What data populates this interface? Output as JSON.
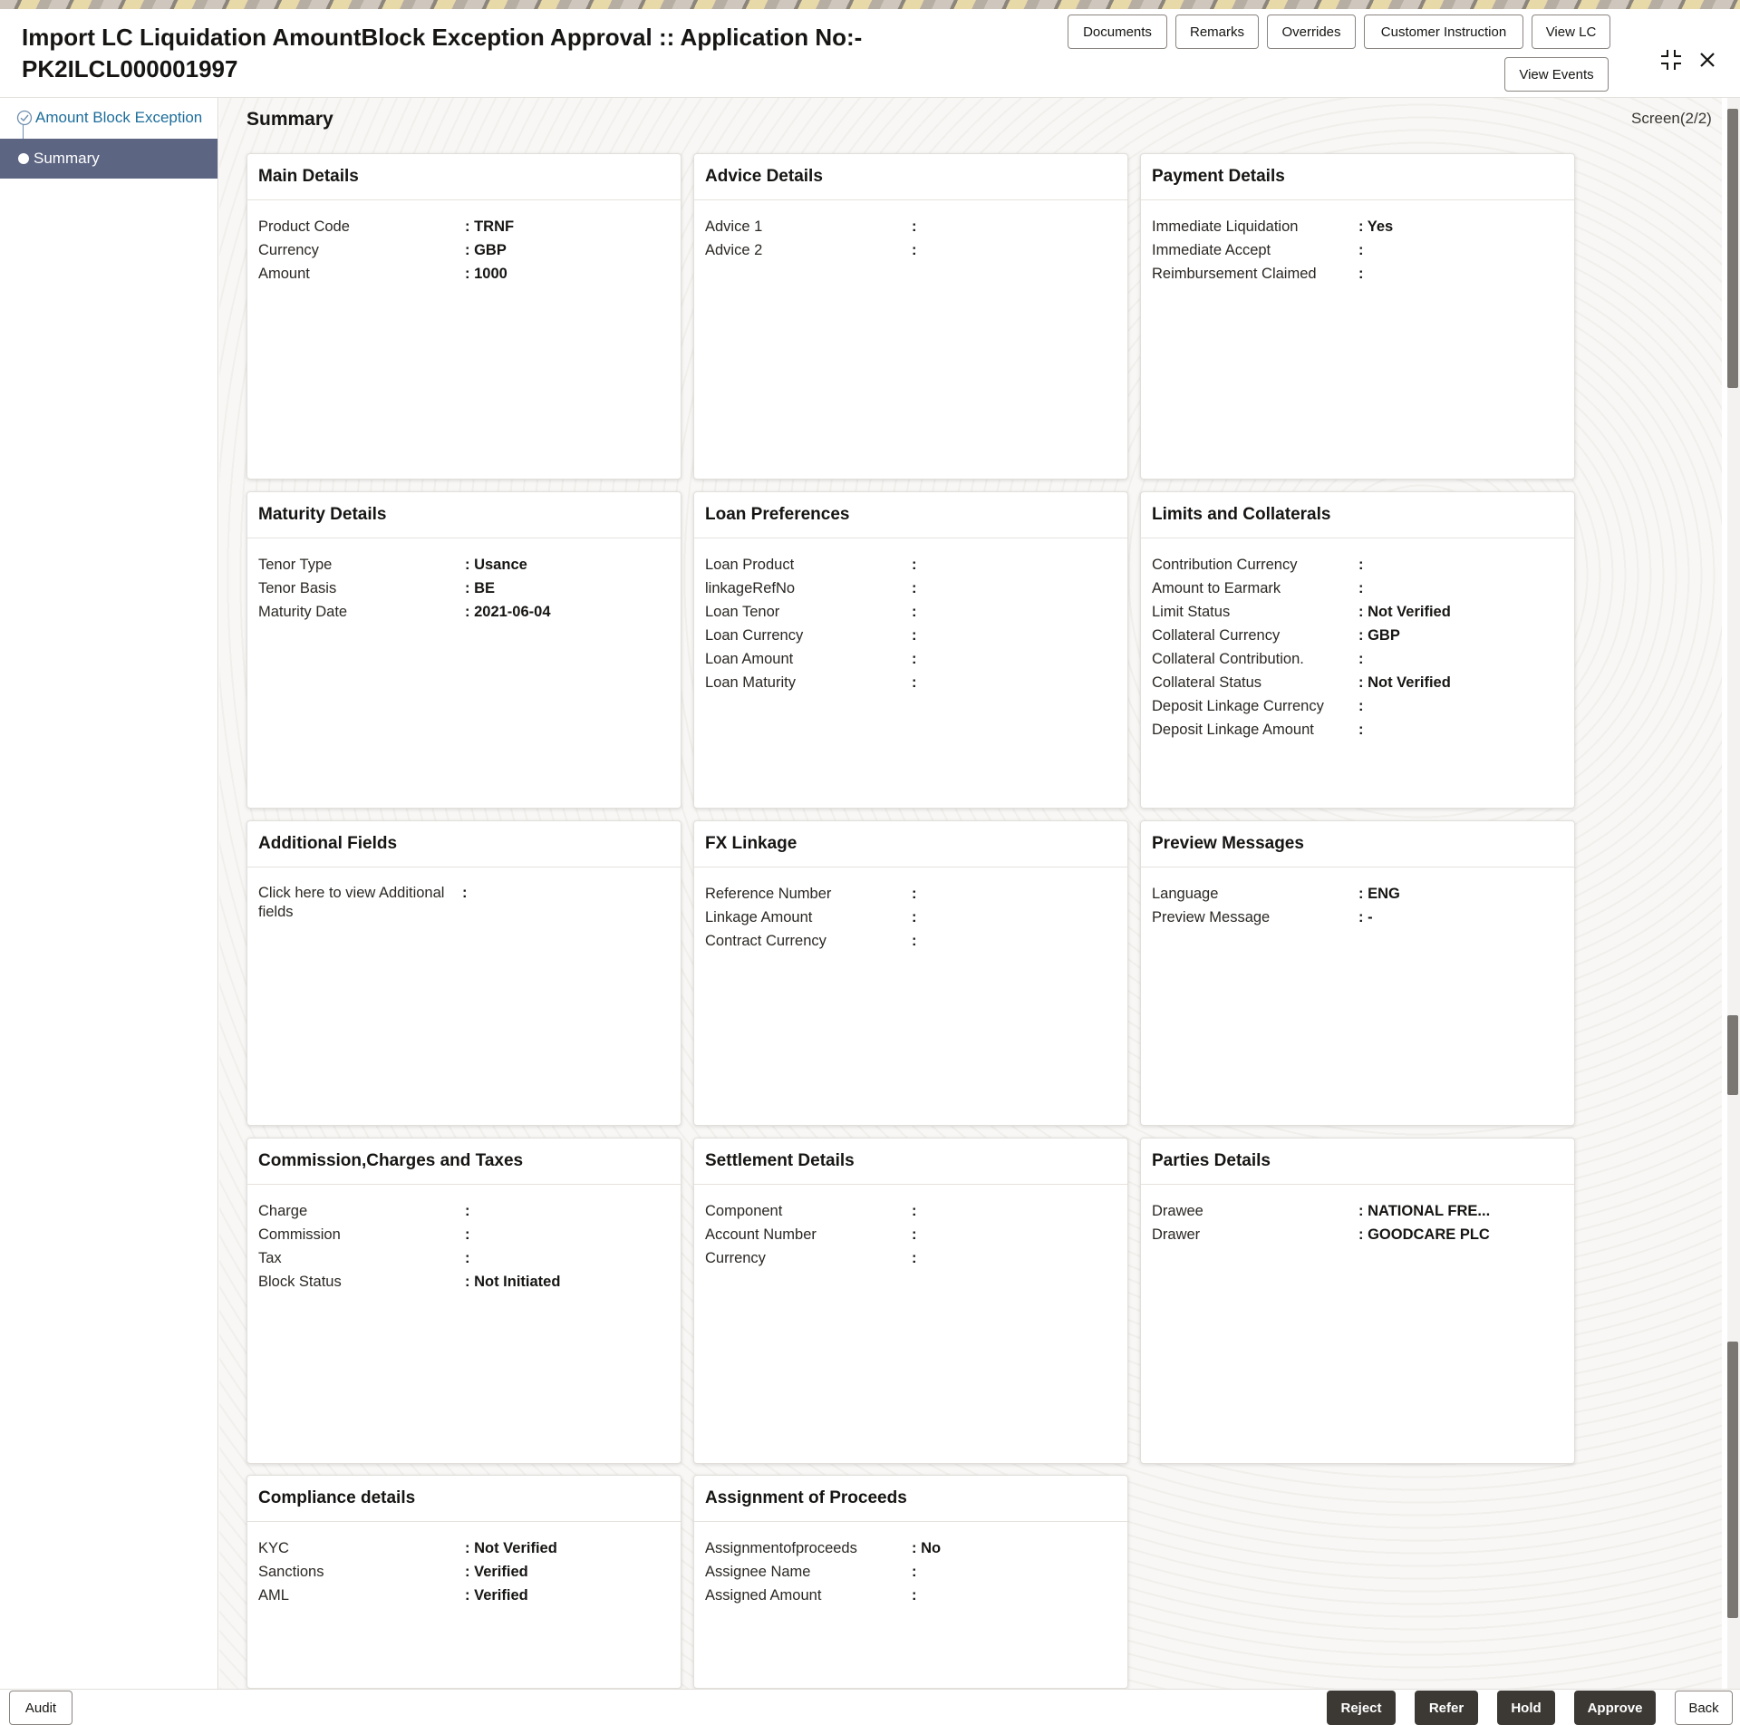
{
  "header": {
    "title_line1": "Import LC Liquidation AmountBlock Exception Approval :: Application No:-",
    "title_line2": "PK2ILCL000001997",
    "buttons": {
      "documents": "Documents",
      "remarks": "Remarks",
      "overrides": "Overrides",
      "customer_instruction": "Customer Instruction",
      "view_lc": "View LC",
      "view_events": "View Events"
    },
    "collapse_icon": "collapse-icon",
    "close_icon": "close-icon"
  },
  "sidebar": {
    "items": [
      {
        "label": "Amount Block Exception",
        "state": "completed"
      },
      {
        "label": "Summary",
        "state": "active"
      }
    ]
  },
  "main": {
    "title": "Summary",
    "screen": "Screen(2/2)"
  },
  "cards": {
    "main_details": {
      "title": "Main Details",
      "rows": [
        {
          "label": "Product Code",
          "value": "TRNF"
        },
        {
          "label": "Currency",
          "value": "GBP"
        },
        {
          "label": "Amount",
          "value": "1000"
        }
      ]
    },
    "advice_details": {
      "title": "Advice Details",
      "rows": [
        {
          "label": "Advice 1",
          "value": ""
        },
        {
          "label": "Advice 2",
          "value": ""
        }
      ]
    },
    "payment_details": {
      "title": "Payment Details",
      "rows": [
        {
          "label": "Immediate Liquidation",
          "value": "Yes"
        },
        {
          "label": "Immediate Accept",
          "value": ""
        },
        {
          "label": "Reimbursement Claimed",
          "value": ""
        }
      ]
    },
    "maturity_details": {
      "title": "Maturity Details",
      "rows": [
        {
          "label": "Tenor Type",
          "value": "Usance"
        },
        {
          "label": "Tenor Basis",
          "value": "BE"
        },
        {
          "label": "Maturity Date",
          "value": "2021-06-04"
        }
      ]
    },
    "loan_preferences": {
      "title": "Loan Preferences",
      "rows": [
        {
          "label": "Loan Product",
          "value": ""
        },
        {
          "label": "linkageRefNo",
          "value": ""
        },
        {
          "label": "Loan Tenor",
          "value": ""
        },
        {
          "label": "Loan Currency",
          "value": ""
        },
        {
          "label": "Loan Amount",
          "value": ""
        },
        {
          "label": "Loan Maturity",
          "value": ""
        }
      ]
    },
    "limits_collaterals": {
      "title": "Limits and Collaterals",
      "rows": [
        {
          "label": "Contribution Currency",
          "value": ""
        },
        {
          "label": "Amount to Earmark",
          "value": ""
        },
        {
          "label": "Limit Status",
          "value": "Not Verified"
        },
        {
          "label": "Collateral Currency",
          "value": "GBP"
        },
        {
          "label": "Collateral Contribution.",
          "value": ""
        },
        {
          "label": "Collateral Status",
          "value": "Not Verified"
        },
        {
          "label": "Deposit Linkage Currency",
          "value": ""
        },
        {
          "label": "Deposit Linkage Amount",
          "value": ""
        }
      ]
    },
    "additional_fields": {
      "title": "Additional Fields",
      "rows": [
        {
          "label": "Click here to view Additional fields",
          "value": ""
        }
      ]
    },
    "fx_linkage": {
      "title": "FX Linkage",
      "rows": [
        {
          "label": "Reference Number",
          "value": ""
        },
        {
          "label": "Linkage Amount",
          "value": ""
        },
        {
          "label": "Contract Currency",
          "value": ""
        }
      ]
    },
    "preview_messages": {
      "title": "Preview Messages",
      "rows": [
        {
          "label": "Language",
          "value": "ENG"
        },
        {
          "label": "Preview Message",
          "value": "-"
        }
      ]
    },
    "commission_charges": {
      "title": "Commission,Charges and Taxes",
      "rows": [
        {
          "label": "Charge",
          "value": ""
        },
        {
          "label": "Commission",
          "value": ""
        },
        {
          "label": "Tax",
          "value": ""
        },
        {
          "label": "Block Status",
          "value": "Not Initiated"
        }
      ]
    },
    "settlement_details": {
      "title": "Settlement Details",
      "rows": [
        {
          "label": "Component",
          "value": ""
        },
        {
          "label": "Account Number",
          "value": ""
        },
        {
          "label": "Currency",
          "value": ""
        }
      ]
    },
    "parties_details": {
      "title": "Parties Details",
      "rows": [
        {
          "label": "Drawee",
          "value": "NATIONAL FRE..."
        },
        {
          "label": "Drawer",
          "value": "GOODCARE PLC"
        }
      ]
    },
    "compliance_details": {
      "title": "Compliance details",
      "rows": [
        {
          "label": "KYC",
          "value": "Not Verified"
        },
        {
          "label": "Sanctions",
          "value": "Verified"
        },
        {
          "label": "AML",
          "value": "Verified"
        }
      ]
    },
    "assignment_proceeds": {
      "title": "Assignment of Proceeds",
      "rows": [
        {
          "label": "Assignmentofproceeds",
          "value": "No"
        },
        {
          "label": "Assignee Name",
          "value": ""
        },
        {
          "label": "Assigned Amount",
          "value": ""
        }
      ]
    }
  },
  "footer": {
    "audit": "Audit",
    "reject": "Reject",
    "refer": "Refer",
    "hold": "Hold",
    "approve": "Approve",
    "back": "Back"
  },
  "colors": {
    "sidebar_active_bg": "#5c6582",
    "link_text": "#1e6e9b",
    "dark_button": "#3c3935"
  }
}
